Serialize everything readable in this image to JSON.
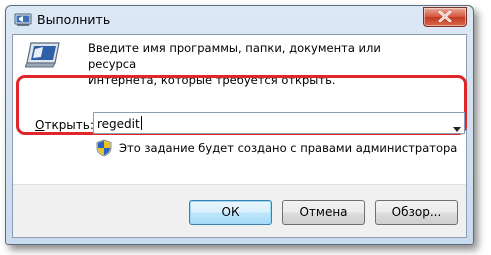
{
  "window": {
    "title": "Выполнить"
  },
  "description": {
    "line1": "Введите имя программы, папки, документа или ресурса",
    "line2": "Интернета, которые требуется открыть."
  },
  "open_field": {
    "label_mnemonic": "О",
    "label_rest": "ткрыть:",
    "value": "regedit"
  },
  "admin_note": "Это задание будет создано с правами администратора",
  "buttons": {
    "ok": "ОК",
    "cancel": "Отмена",
    "browse": "Обзор..."
  },
  "colors": {
    "highlight": "#e1262a",
    "close_button": "#c2391f",
    "default_button_border": "#3c7fb1"
  },
  "icons": {
    "title": "run-icon",
    "dialog": "run-icon",
    "close": "close-icon",
    "dropdown": "chevron-down-icon",
    "admin": "uac-shield-icon"
  }
}
